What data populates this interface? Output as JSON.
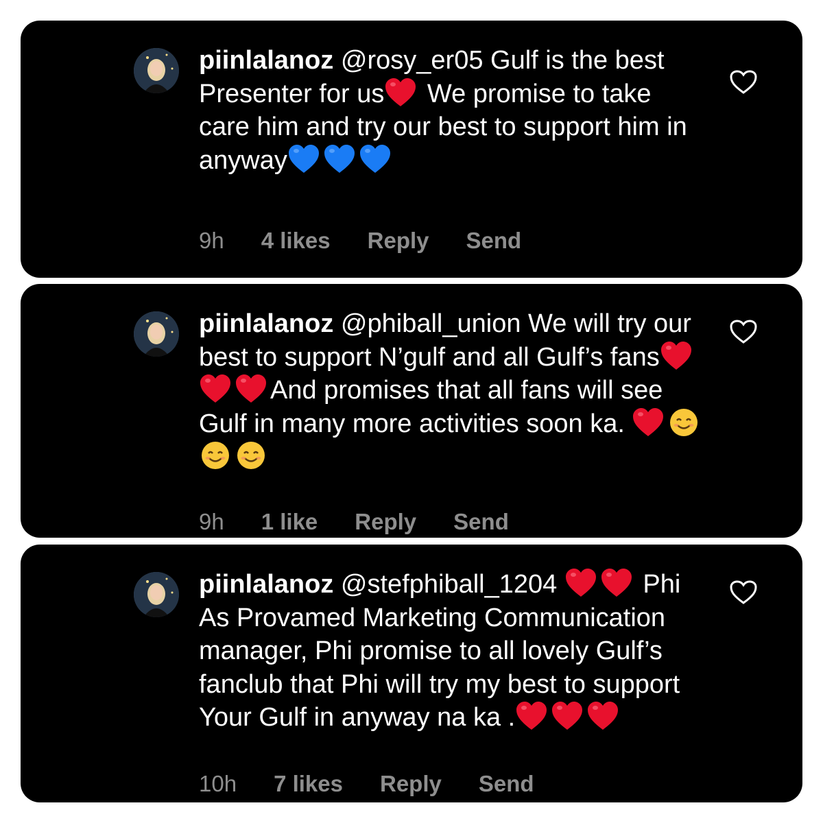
{
  "comments": [
    {
      "username": "piinlalanoz",
      "mention": "@rosy_er05",
      "text_parts": [
        " Gulf is the best Presenter for us",
        " We promise to take care him and try our best to support him in anyway"
      ],
      "emojis_a": [
        "red-heart"
      ],
      "emojis_b": [
        "blue-heart",
        "blue-heart",
        "blue-heart"
      ],
      "time": "9h",
      "likes": "4 likes",
      "reply": "Reply",
      "send": "Send"
    },
    {
      "username": "piinlalanoz",
      "mention": "@phiball_union",
      "text_parts": [
        " We will try our best to support N’gulf and all Gulf’s fans",
        "And promises that all fans will see Gulf in many more activities soon ka. "
      ],
      "emojis_a": [
        "red-heart",
        "red-heart",
        "red-heart"
      ],
      "emojis_b": [
        "red-heart",
        "smiling-face",
        "smiling-face",
        "smiling-face"
      ],
      "time": "9h",
      "likes": "1 like",
      "reply": "Reply",
      "send": "Send"
    },
    {
      "username": "piinlalanoz",
      "mention": "@stefphiball_1204",
      "text_parts": [
        " ",
        " Phi As Provamed Marketing Communication manager, Phi promise to all lovely Gulf’s fanclub that Phi will try my best to support Your Gulf in anyway na ka ."
      ],
      "emojis_a": [
        "red-heart",
        "red-heart"
      ],
      "emojis_b": [
        "red-heart",
        "red-heart",
        "red-heart"
      ],
      "time": "10h",
      "likes": "7 likes",
      "reply": "Reply",
      "send": "Send"
    }
  ],
  "colors": {
    "card_bg": "#000000",
    "text": "#ffffff",
    "meta": "#8e8e8e",
    "red_heart": "#e8112d",
    "blue_heart": "#1a7cf5",
    "smile": "#f9c73a"
  },
  "icons": {
    "like": "heart-outline-icon",
    "avatar": "avatar"
  }
}
